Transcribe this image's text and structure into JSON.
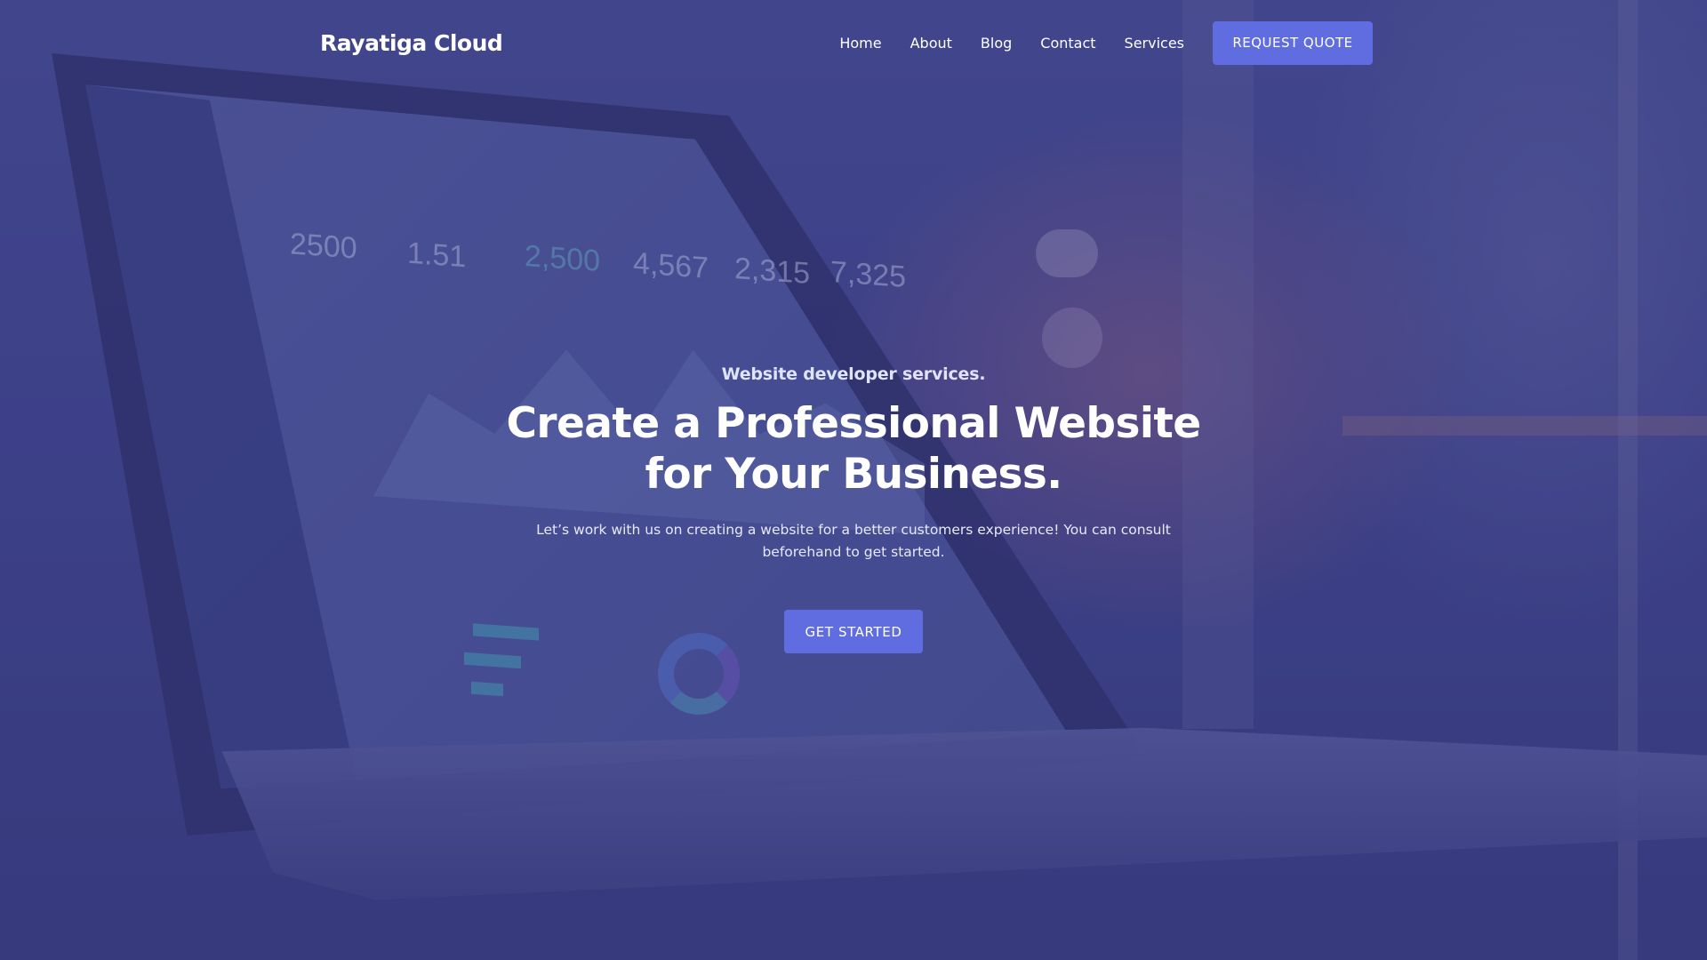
{
  "brand": {
    "name": "Rayatiga Cloud"
  },
  "nav": {
    "links": [
      "Home",
      "About",
      "Blog",
      "Contact",
      "Services"
    ],
    "cta_label": "REQUEST QUOTE"
  },
  "hero": {
    "eyebrow": "Website developer services.",
    "headline": "Create a Professional Website for Your Business.",
    "lead": "Let’s work with us on creating a website for a better customers experience! You can consult beforehand to get started.",
    "cta_label": "GET STARTED"
  },
  "background": {
    "screen_stats": [
      "2500",
      "1.51",
      "2,500",
      "4,567",
      "2,315",
      "7,325"
    ]
  },
  "colors": {
    "accent": "#5f6de0",
    "overlay": "#3c3f82",
    "text": "#ffffff"
  }
}
